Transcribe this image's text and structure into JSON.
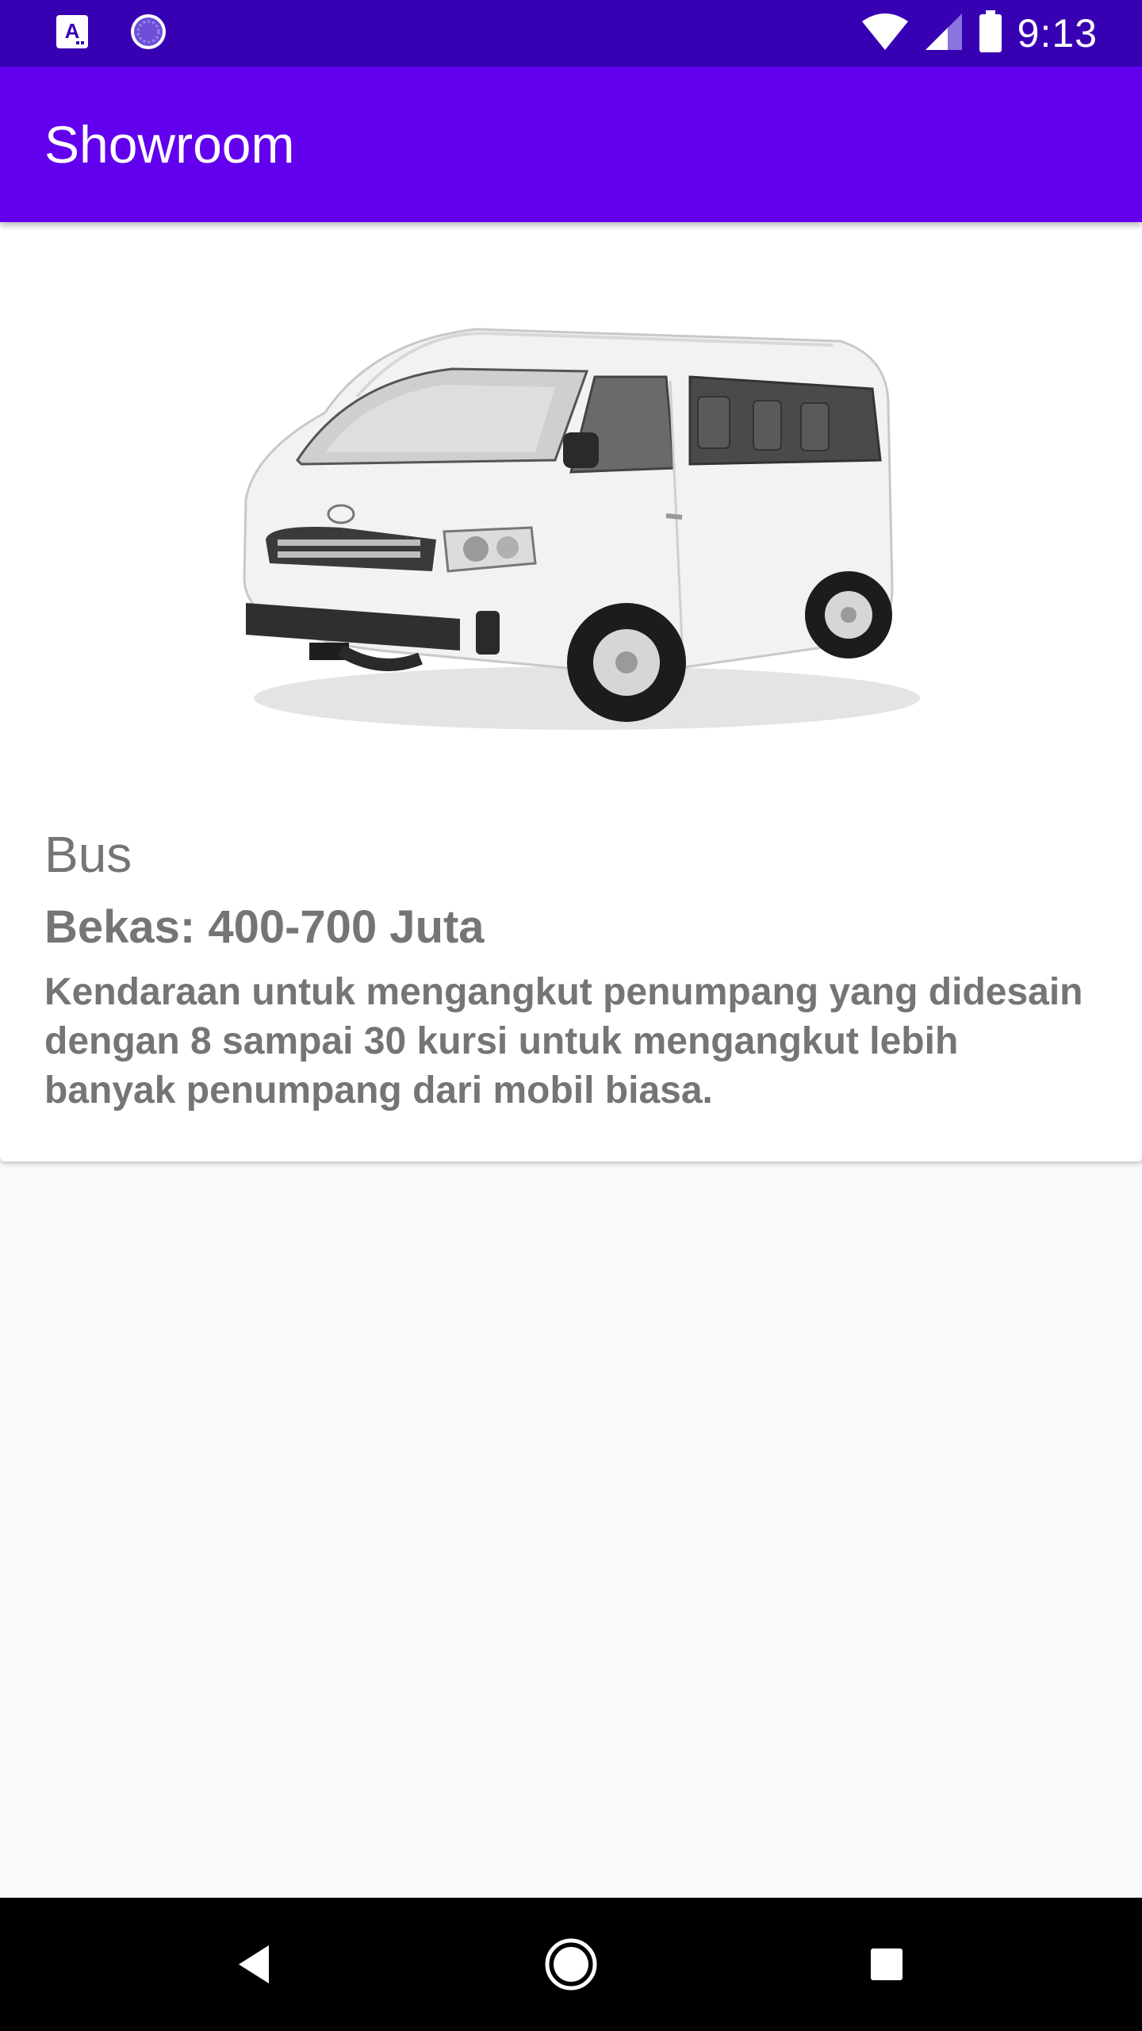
{
  "status_bar": {
    "time": "9:13",
    "icons": [
      "a-notification-icon",
      "loading-circle-icon",
      "wifi-icon",
      "signal-icon",
      "battery-icon"
    ]
  },
  "app_bar": {
    "title": "Showroom"
  },
  "item": {
    "name": "Bus",
    "price": "Bekas: 400-700 Juta",
    "description": "Kendaraan untuk mengangkut penumpang yang didesain dengan 8 sampai 30 kursi untuk mengangkut lebih banyak penumpang dari mobil biasa."
  },
  "nav_bar": {
    "icons": [
      "back-icon",
      "home-icon",
      "recents-icon"
    ]
  },
  "colors": {
    "status_bar": "#3700b3",
    "app_bar": "#6200ee",
    "text_secondary": "#757575",
    "background": "#fafafa"
  }
}
